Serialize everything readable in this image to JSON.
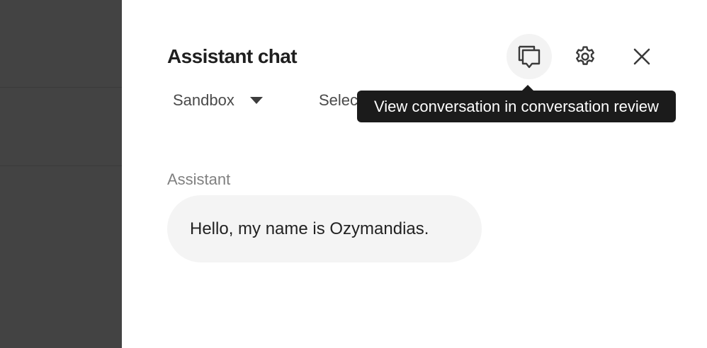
{
  "panel": {
    "title": "Assistant chat"
  },
  "toolbar": {
    "conversation_icon": "chat-bubbles-icon",
    "settings_icon": "gear-icon",
    "close_icon": "close-icon"
  },
  "environment": {
    "selected": "Sandbox"
  },
  "second_select": {
    "visible_text": "Selec"
  },
  "tooltip": {
    "text": "View conversation in conversation review"
  },
  "messages": [
    {
      "sender": "Assistant",
      "text": "Hello, my name is Ozymandias."
    }
  ],
  "colors": {
    "backdrop": "#434343",
    "tooltip_bg": "#1b1b1b",
    "bubble_bg": "#f4f4f4"
  }
}
